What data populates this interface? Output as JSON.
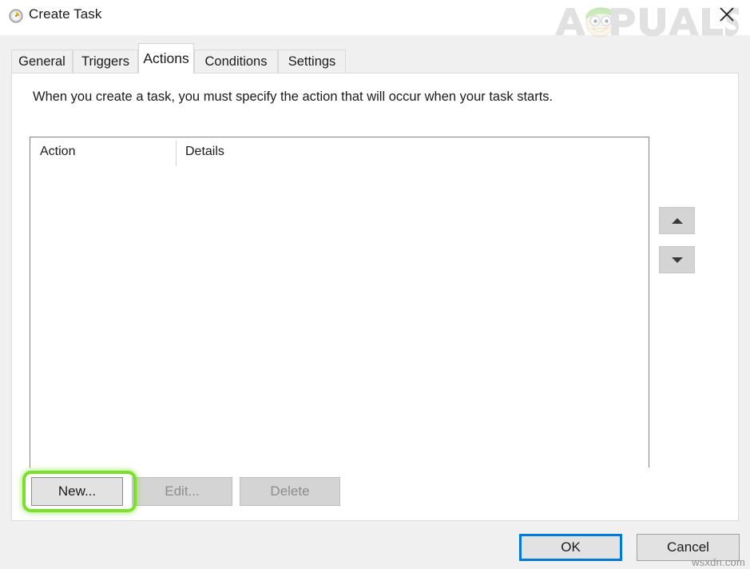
{
  "window": {
    "title": "Create Task",
    "icon": "clock-icon",
    "close_label": "✕"
  },
  "branding": {
    "logo_text": "APPUALS",
    "watermark_text": "wsxdn.com"
  },
  "tabs": [
    {
      "label": "General",
      "selected": false
    },
    {
      "label": "Triggers",
      "selected": false
    },
    {
      "label": "Actions",
      "selected": true
    },
    {
      "label": "Conditions",
      "selected": false
    },
    {
      "label": "Settings",
      "selected": false
    }
  ],
  "main": {
    "instruction": "When you create a task, you must specify the action that will occur when your task starts.",
    "list": {
      "columns": [
        "Action",
        "Details"
      ],
      "rows": []
    },
    "reorder": {
      "move_up_label": "▲",
      "move_down_label": "▼"
    },
    "buttons": {
      "new": "New...",
      "edit": "Edit...",
      "delete": "Delete"
    }
  },
  "footer": {
    "ok": "OK",
    "cancel": "Cancel"
  },
  "annotation": {
    "highlight_color": "#79e02b",
    "highlight_target": "New..."
  },
  "colors": {
    "accent_focus": "#0078d7",
    "dialog_background": "#f0f0f0",
    "panel_background": "#ffffff",
    "button_face": "#d8d8d8"
  }
}
